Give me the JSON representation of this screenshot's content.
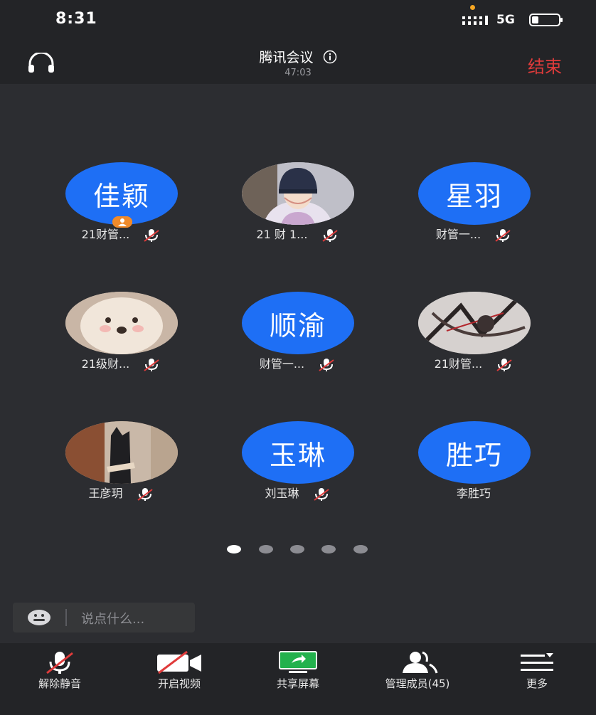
{
  "status_bar": {
    "time": "8:31",
    "network": "5G"
  },
  "header": {
    "title": "腾讯会议",
    "elapsed": "47:03",
    "end_label": "结束"
  },
  "participants": [
    {
      "avatar_text": "佳颖",
      "name": "21财管...",
      "muted": true,
      "host": true,
      "has_photo": false
    },
    {
      "avatar_text": "",
      "name": "21 财 1...",
      "muted": true,
      "host": false,
      "has_photo": true
    },
    {
      "avatar_text": "星羽",
      "name": "财管一...",
      "muted": true,
      "host": false,
      "has_photo": false
    },
    {
      "avatar_text": "",
      "name": "21级财...",
      "muted": true,
      "host": false,
      "has_photo": true
    },
    {
      "avatar_text": "顺渝",
      "name": "财管一...",
      "muted": true,
      "host": false,
      "has_photo": false
    },
    {
      "avatar_text": "",
      "name": "21财管...",
      "muted": true,
      "host": false,
      "has_photo": true
    },
    {
      "avatar_text": "",
      "name": "王彦玥",
      "muted": true,
      "host": false,
      "has_photo": true
    },
    {
      "avatar_text": "玉琳",
      "name": "刘玉琳",
      "muted": true,
      "host": false,
      "has_photo": false
    },
    {
      "avatar_text": "胜巧",
      "name": "李胜巧",
      "muted": false,
      "host": false,
      "has_photo": false
    }
  ],
  "pagination": {
    "total_pages": 5,
    "current_page": 1
  },
  "chat": {
    "placeholder": "说点什么..."
  },
  "toolbar": [
    {
      "icon": "microphone-muted-icon",
      "label": "解除静音"
    },
    {
      "icon": "video-off-icon",
      "label": "开启视频"
    },
    {
      "icon": "share-screen-icon",
      "label": "共享屏幕"
    },
    {
      "icon": "members-icon",
      "label": "管理成员(45)"
    },
    {
      "icon": "more-menu-icon",
      "label": "更多"
    }
  ],
  "colors": {
    "avatar_blue": "#1e6ff5",
    "end_red": "#e03b3b",
    "host_orange": "#f08a2a",
    "share_green": "#23b14d"
  }
}
